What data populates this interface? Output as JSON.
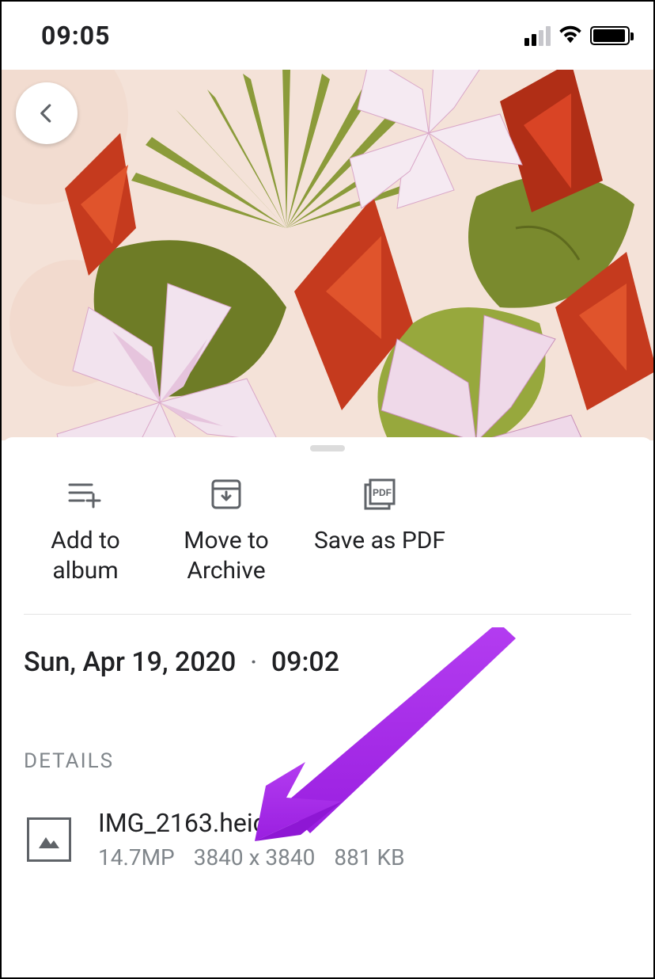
{
  "status": {
    "time": "09:05"
  },
  "actions": {
    "add_to_album": "Add to album",
    "move_to_archive": "Move to Archive",
    "save_as_pdf": "Save as PDF"
  },
  "datetime": {
    "date": "Sun, Apr 19, 2020",
    "time": "09:02"
  },
  "details": {
    "heading": "DETAILS",
    "filename": "IMG_2163.heic",
    "megapixels": "14.7MP",
    "dimensions": "3840 x 3840",
    "size": "881 KB"
  }
}
